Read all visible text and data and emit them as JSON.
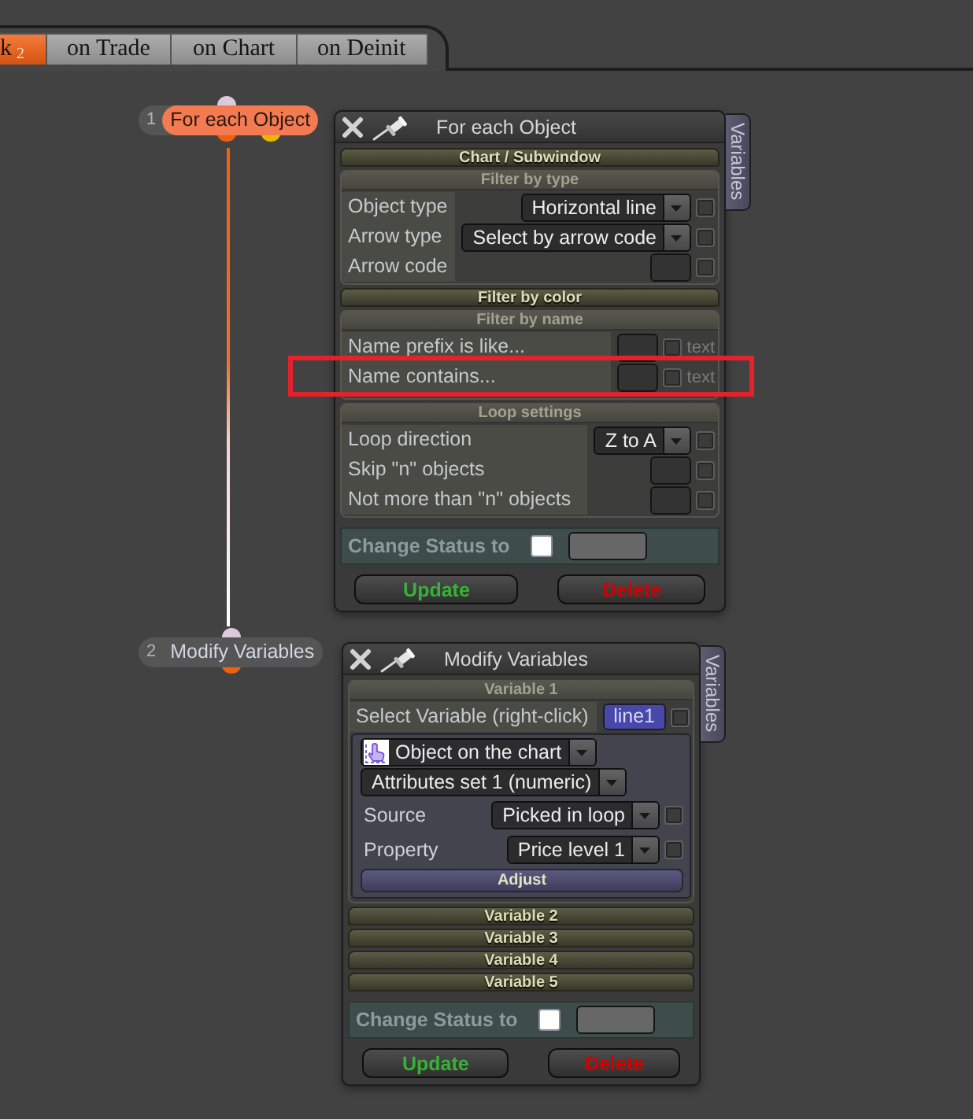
{
  "tabs": [
    {
      "label": "k",
      "badge": "2",
      "selected": true
    },
    {
      "label": "on Trade",
      "selected": false
    },
    {
      "label": "on Chart",
      "selected": false
    },
    {
      "label": "on Deinit",
      "selected": false
    }
  ],
  "nodes": [
    {
      "number": "1",
      "title": "For each Object",
      "selected": true,
      "outputs": [
        {
          "color": "#f06010"
        },
        {
          "color": "#e6b800"
        }
      ]
    },
    {
      "number": "2",
      "title": "Modify Variables",
      "selected": false,
      "outputs": [
        {
          "color": "#f06010"
        }
      ]
    }
  ],
  "panels": [
    {
      "title": "For each Object",
      "side_tab": "Variables",
      "sections": [
        {
          "label": "Chart / Subwindow",
          "expanded": false
        },
        {
          "label": "Filter by type",
          "expanded": true,
          "rows": [
            {
              "kind": "select",
              "label": "Object type",
              "value": "Horizontal line",
              "checked": false,
              "highlighted": false
            },
            {
              "kind": "select",
              "label": "Arrow type",
              "value": "Select by arrow code",
              "checked": false,
              "highlighted": false
            },
            {
              "kind": "input",
              "label": "Arrow code",
              "checked": false,
              "highlighted": false
            }
          ]
        },
        {
          "label": "Filter by color",
          "expanded": false
        },
        {
          "label": "Filter by name",
          "expanded": true,
          "rows": [
            {
              "kind": "text_input",
              "label": "Name prefix is like...",
              "suffix": "text",
              "checked": false,
              "highlighted": false
            },
            {
              "kind": "text_input",
              "label": "Name contains...",
              "suffix": "text",
              "checked": false,
              "highlighted": true
            }
          ]
        },
        {
          "label": "Loop settings",
          "expanded": true,
          "rows": [
            {
              "kind": "select",
              "label": "Loop direction",
              "value": "Z to A",
              "checked": false,
              "highlighted": false
            },
            {
              "kind": "input",
              "label": "Skip \"n\" objects",
              "checked": false,
              "highlighted": false
            },
            {
              "kind": "input",
              "label": "Not more than \"n\" objects",
              "checked": false,
              "highlighted": false
            }
          ]
        }
      ],
      "status": {
        "label": "Change Status to",
        "checked": false
      },
      "buttons": [
        {
          "kind": "update",
          "label": "Update"
        },
        {
          "kind": "delete",
          "label": "Delete"
        }
      ]
    },
    {
      "title": "Modify Variables",
      "side_tab": "Variables",
      "sections": [
        {
          "label": "Variable 1",
          "expanded": true,
          "rows": [
            {
              "kind": "variable",
              "label": "Select Variable (right-click)",
              "value": "line1",
              "checked": false
            },
            {
              "kind": "group",
              "rows": [
                {
                  "kind": "icon_select",
                  "value": "Object on the chart"
                },
                {
                  "kind": "wide_select",
                  "value": "Attributes set 1 (numeric)"
                },
                {
                  "kind": "select",
                  "label": "Source",
                  "value": "Picked in loop",
                  "checked": false
                },
                {
                  "kind": "select",
                  "label": "Property",
                  "value": "Price level 1",
                  "checked": false
                },
                {
                  "kind": "button",
                  "label": "Adjust"
                }
              ]
            }
          ]
        },
        {
          "label": "Variable 2",
          "expanded": false
        },
        {
          "label": "Variable 3",
          "expanded": false
        },
        {
          "label": "Variable 4",
          "expanded": false
        },
        {
          "label": "Variable 5",
          "expanded": false
        }
      ],
      "status": {
        "label": "Change Status to",
        "checked": false
      },
      "buttons": [
        {
          "kind": "update",
          "label": "Update"
        },
        {
          "kind": "delete",
          "label": "Delete"
        }
      ]
    }
  ]
}
